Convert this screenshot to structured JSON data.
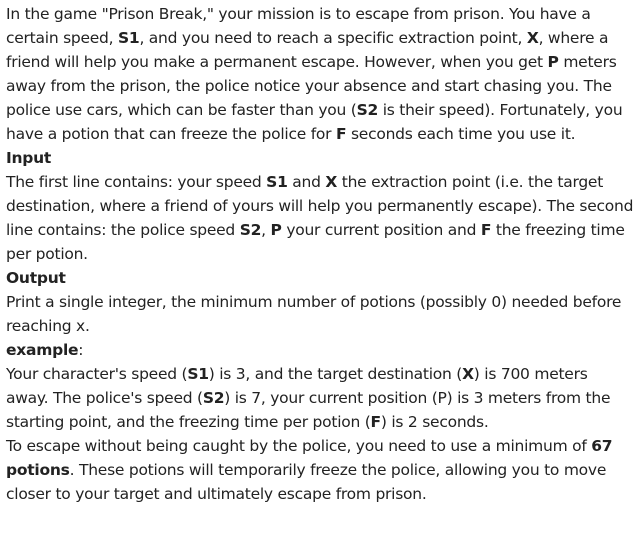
{
  "intro": {
    "t1": "In the game \"Prison Break,\" your mission is to escape from prison. You have a certain speed, ",
    "s1": "S1",
    "t2": ", and you need to reach a specific extraction point, ",
    "x": "X",
    "t3": ", where a friend will help you make a permanent escape. However, when you get ",
    "p": "P",
    "t4": " meters away from the prison, the police notice your absence and start chasing you. The police use cars, which can be faster than you (",
    "s2": "S2",
    "t5": " is their speed). Fortunately, you have a potion that can freeze the police for ",
    "f": "F",
    "t6": " seconds each time you use it."
  },
  "input": {
    "heading": "Input",
    "t1": "The first line contains: your speed ",
    "s1": "S1",
    "t2": " and ",
    "x": "X",
    "t3": " the extraction point (i.e. the target destination, where a friend of yours will help you permanently escape). The second line contains: the police speed ",
    "s2": "S2",
    "t4": ", ",
    "p": "P",
    "t5": " your current position and ",
    "f": "F",
    "t6": " the freezing time per potion."
  },
  "output": {
    "heading": "Output",
    "text": "Print a single integer, the minimum number of potions (possibly 0) needed before reaching x."
  },
  "example": {
    "heading": "example",
    "colon": ":",
    "t1": "Your character's speed (",
    "s1": "S1",
    "t2": ") is 3, and the target destination (",
    "x": "X",
    "t3": ") is 700 meters away. The police's speed (",
    "s2": "S2",
    "t4": ") is 7, your current position (P) is 3 meters from the starting point, and the freezing time per potion (",
    "f": "F",
    "t5": ") is 2 seconds.",
    "t6": "To escape without being caught by the police, you need to use a minimum of ",
    "answer": "67 potions",
    "t7": ". These potions will temporarily freeze the police, allowing you to move closer to your target and ultimately escape from prison."
  }
}
